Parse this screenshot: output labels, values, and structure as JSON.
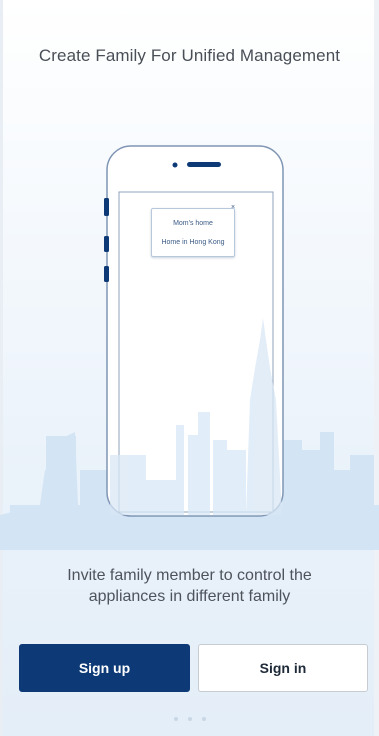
{
  "header": {
    "title": "Create Family For Unified Management"
  },
  "illustration": {
    "family_options": [
      "Mom's home",
      "Home in Hong Kong"
    ],
    "close_glyph": "×"
  },
  "description": {
    "line1": "Invite family member to control the",
    "line2": "appliances in different family"
  },
  "actions": {
    "sign_up_label": "Sign up",
    "sign_in_label": "Sign in"
  },
  "pager": {
    "page_count": 3,
    "active_index": 0
  },
  "colors": {
    "primary": "#0d3a76",
    "skyline": "#d3e4f4",
    "phone_outline": "#7f95b3"
  }
}
